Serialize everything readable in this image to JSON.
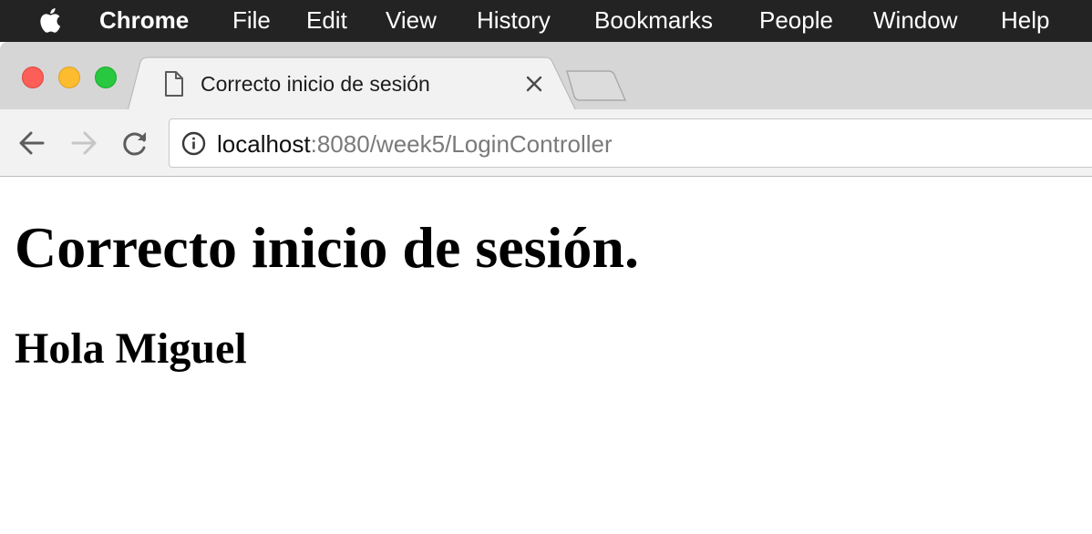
{
  "menubar": {
    "apple_icon": "apple-logo-icon",
    "items": [
      "Chrome",
      "File",
      "Edit",
      "View",
      "History",
      "Bookmarks",
      "People",
      "Window",
      "Help"
    ]
  },
  "window_controls": {
    "close_color": "#fc5f57",
    "minimize_color": "#fdbc2e",
    "zoom_color": "#28c840"
  },
  "tab": {
    "icon": "document-icon",
    "title": "Correcto inicio de sesión",
    "close_icon": "close-icon"
  },
  "toolbar": {
    "back_icon": "back-arrow-icon",
    "forward_icon": "forward-arrow-icon",
    "reload_icon": "reload-icon",
    "info_icon": "info-icon",
    "url_host": "localhost",
    "url_rest": ":8080/week5/LoginController"
  },
  "page": {
    "heading": "Correcto inicio de sesión.",
    "subheading": "Hola Miguel"
  }
}
